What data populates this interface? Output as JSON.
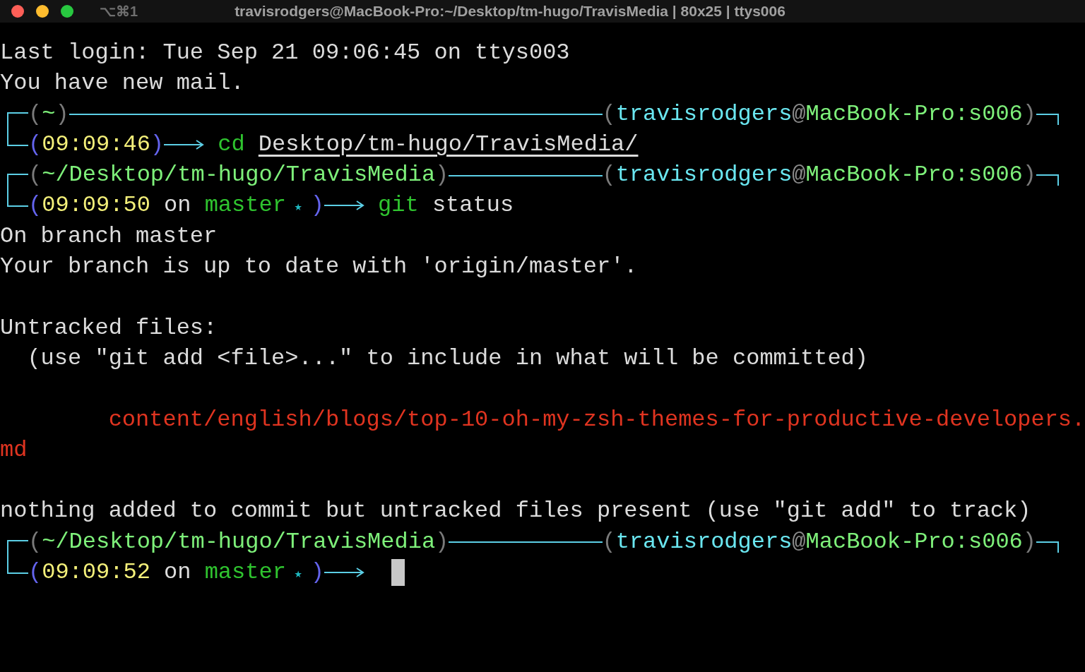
{
  "window": {
    "title": "travisrodgers@MacBook-Pro:~/Desktop/tm-hugo/TravisMedia | 80x25 | ttys006",
    "shortcut": "⌥⌘1"
  },
  "lines": [
    {
      "kind": "output",
      "segments": [
        {
          "text": "Last login: Tue Sep 21 09:06:45 on ttys003",
          "kind": "plain"
        }
      ]
    },
    {
      "kind": "output",
      "segments": [
        {
          "text": "You have new mail.",
          "kind": "plain"
        }
      ]
    },
    {
      "kind": "prompt_top",
      "left": [
        {
          "text": "(",
          "kind": "paren"
        },
        {
          "text": "~",
          "kind": "path"
        },
        {
          "text": ")",
          "kind": "paren"
        }
      ],
      "right": [
        {
          "text": "(",
          "kind": "paren"
        },
        {
          "text": "travisrodgers",
          "kind": "user"
        },
        {
          "text": "@",
          "kind": "at"
        },
        {
          "text": "MacBook-Pro:s006",
          "kind": "host"
        },
        {
          "text": ")",
          "kind": "paren"
        }
      ]
    },
    {
      "kind": "prompt_bottom",
      "status": [
        {
          "text": "(",
          "kind": "bracket"
        },
        {
          "text": "09:09:46",
          "kind": "time"
        },
        {
          "text": ")",
          "kind": "bracket"
        }
      ],
      "command": [
        {
          "text": "cd",
          "kind": "command"
        },
        {
          "text": "Desktop/tm-hugo/TravisMedia/",
          "kind": "argument"
        }
      ],
      "cursor": false
    },
    {
      "kind": "prompt_top",
      "left": [
        {
          "text": "(",
          "kind": "paren"
        },
        {
          "text": "~/Desktop/tm-hugo/TravisMedia",
          "kind": "path"
        },
        {
          "text": ")",
          "kind": "paren"
        }
      ],
      "right": [
        {
          "text": "(",
          "kind": "paren"
        },
        {
          "text": "travisrodgers",
          "kind": "user"
        },
        {
          "text": "@",
          "kind": "at"
        },
        {
          "text": "MacBook-Pro:s006",
          "kind": "host"
        },
        {
          "text": ")",
          "kind": "paren"
        }
      ]
    },
    {
      "kind": "prompt_bottom",
      "status": [
        {
          "text": "(",
          "kind": "bracket"
        },
        {
          "text": "09:09:50",
          "kind": "time"
        },
        {
          "text": " on ",
          "kind": "plain"
        },
        {
          "text": "master",
          "kind": "branch"
        },
        {
          "text": "★",
          "kind": "star"
        },
        {
          "text": ")",
          "kind": "bracket"
        }
      ],
      "command": [
        {
          "text": "git",
          "kind": "command"
        },
        {
          "text": "status",
          "kind": "plain"
        }
      ],
      "cursor": false
    },
    {
      "kind": "output",
      "segments": [
        {
          "text": "On branch master",
          "kind": "plain"
        }
      ]
    },
    {
      "kind": "output",
      "segments": [
        {
          "text": "Your branch is up to date with 'origin/master'.",
          "kind": "plain"
        }
      ]
    },
    {
      "kind": "blank"
    },
    {
      "kind": "output",
      "segments": [
        {
          "text": "Untracked files:",
          "kind": "plain"
        }
      ]
    },
    {
      "kind": "output",
      "segments": [
        {
          "text": "  (use \"git add <file>...\" to include in what will be committed)",
          "kind": "plain"
        }
      ]
    },
    {
      "kind": "blank"
    },
    {
      "kind": "output",
      "segments": [
        {
          "text": "        content/english/blogs/top-10-oh-my-zsh-themes-for-productive-developers.",
          "kind": "error"
        }
      ]
    },
    {
      "kind": "output",
      "segments": [
        {
          "text": "md",
          "kind": "error"
        }
      ]
    },
    {
      "kind": "blank"
    },
    {
      "kind": "output",
      "segments": [
        {
          "text": "nothing added to commit but untracked files present (use \"git add\" to track)",
          "kind": "plain"
        }
      ]
    },
    {
      "kind": "prompt_top",
      "left": [
        {
          "text": "(",
          "kind": "paren"
        },
        {
          "text": "~/Desktop/tm-hugo/TravisMedia",
          "kind": "path"
        },
        {
          "text": ")",
          "kind": "paren"
        }
      ],
      "right": [
        {
          "text": "(",
          "kind": "paren"
        },
        {
          "text": "travisrodgers",
          "kind": "user"
        },
        {
          "text": "@",
          "kind": "at"
        },
        {
          "text": "MacBook-Pro:s006",
          "kind": "host"
        },
        {
          "text": ")",
          "kind": "paren"
        }
      ]
    },
    {
      "kind": "prompt_bottom",
      "status": [
        {
          "text": "(",
          "kind": "bracket"
        },
        {
          "text": "09:09:52",
          "kind": "time"
        },
        {
          "text": " on ",
          "kind": "plain"
        },
        {
          "text": "master",
          "kind": "branch"
        },
        {
          "text": "★",
          "kind": "star"
        },
        {
          "text": ")",
          "kind": "bracket"
        }
      ],
      "cursor": true
    }
  ]
}
